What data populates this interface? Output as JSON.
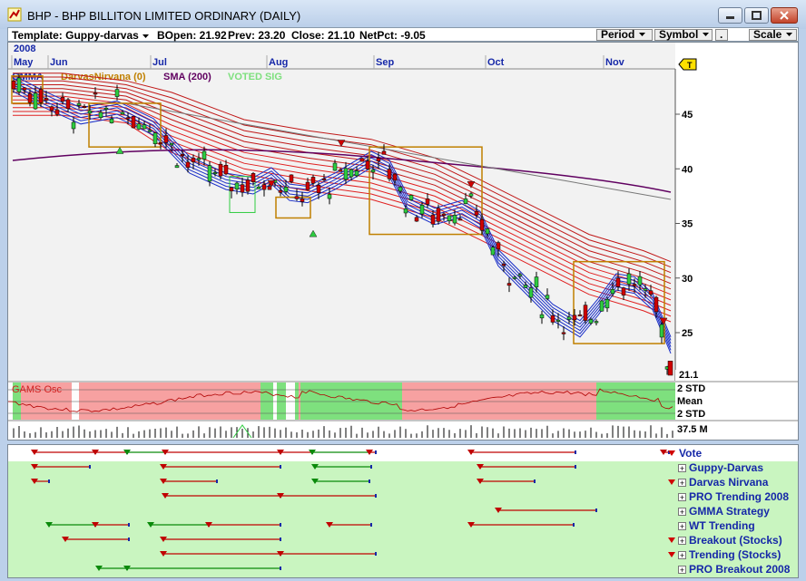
{
  "window": {
    "title": "BHP - BHP BILLITON LIMITED  ORDINARY (DAILY)"
  },
  "toolbar": {
    "template": "Template: Guppy-darvas",
    "bopen": "BOpen: 21.92",
    "prev": "Prev: 23.20",
    "close": "Close: 21.10",
    "netpct": "NetPct: -9.05",
    "period": "Period",
    "symbol": "Symbol",
    "dot": ".",
    "scale": "Scale"
  },
  "chart": {
    "year": "2008",
    "months": [
      "May",
      "Jun",
      "Jul",
      "Aug",
      "Sep",
      "Oct",
      "Nov"
    ],
    "legend": [
      "GMMA",
      "DarvasNirvana (0)",
      "SMA (200)",
      "VOTED SIG"
    ],
    "legend_colors": [
      "#1628a8",
      "#c08000",
      "#600060",
      "#7ee07e"
    ],
    "y_ticks": [
      "45",
      "40",
      "35",
      "30",
      "25"
    ],
    "last_price": "21.1",
    "marker": "T",
    "osc_title": "GAMS Osc",
    "osc_labels": [
      "2 STD",
      "Mean",
      "2 STD"
    ],
    "volume_label": "37.5 M"
  },
  "chart_data": {
    "type": "candlestick",
    "x": [
      "May",
      "Jun",
      "Jul",
      "Aug",
      "Sep",
      "Oct",
      "Nov"
    ],
    "y_ticks": [
      45,
      40,
      35,
      30,
      25
    ],
    "last_close": 21.1,
    "bopen": 21.92,
    "prev": 23.2,
    "close": 21.1,
    "netpct": -9.05
  },
  "strategies": {
    "vote_label": "Vote",
    "items": [
      "Guppy-Darvas",
      "Darvas Nirvana",
      "PRO Trending 2008",
      "GMMA Strategy",
      "WT Trending",
      "Breakout (Stocks)",
      "Trending (Stocks)",
      "PRO Breakout 2008"
    ],
    "flags": [
      false,
      true,
      false,
      false,
      false,
      true,
      true,
      false
    ],
    "plus": "+"
  }
}
